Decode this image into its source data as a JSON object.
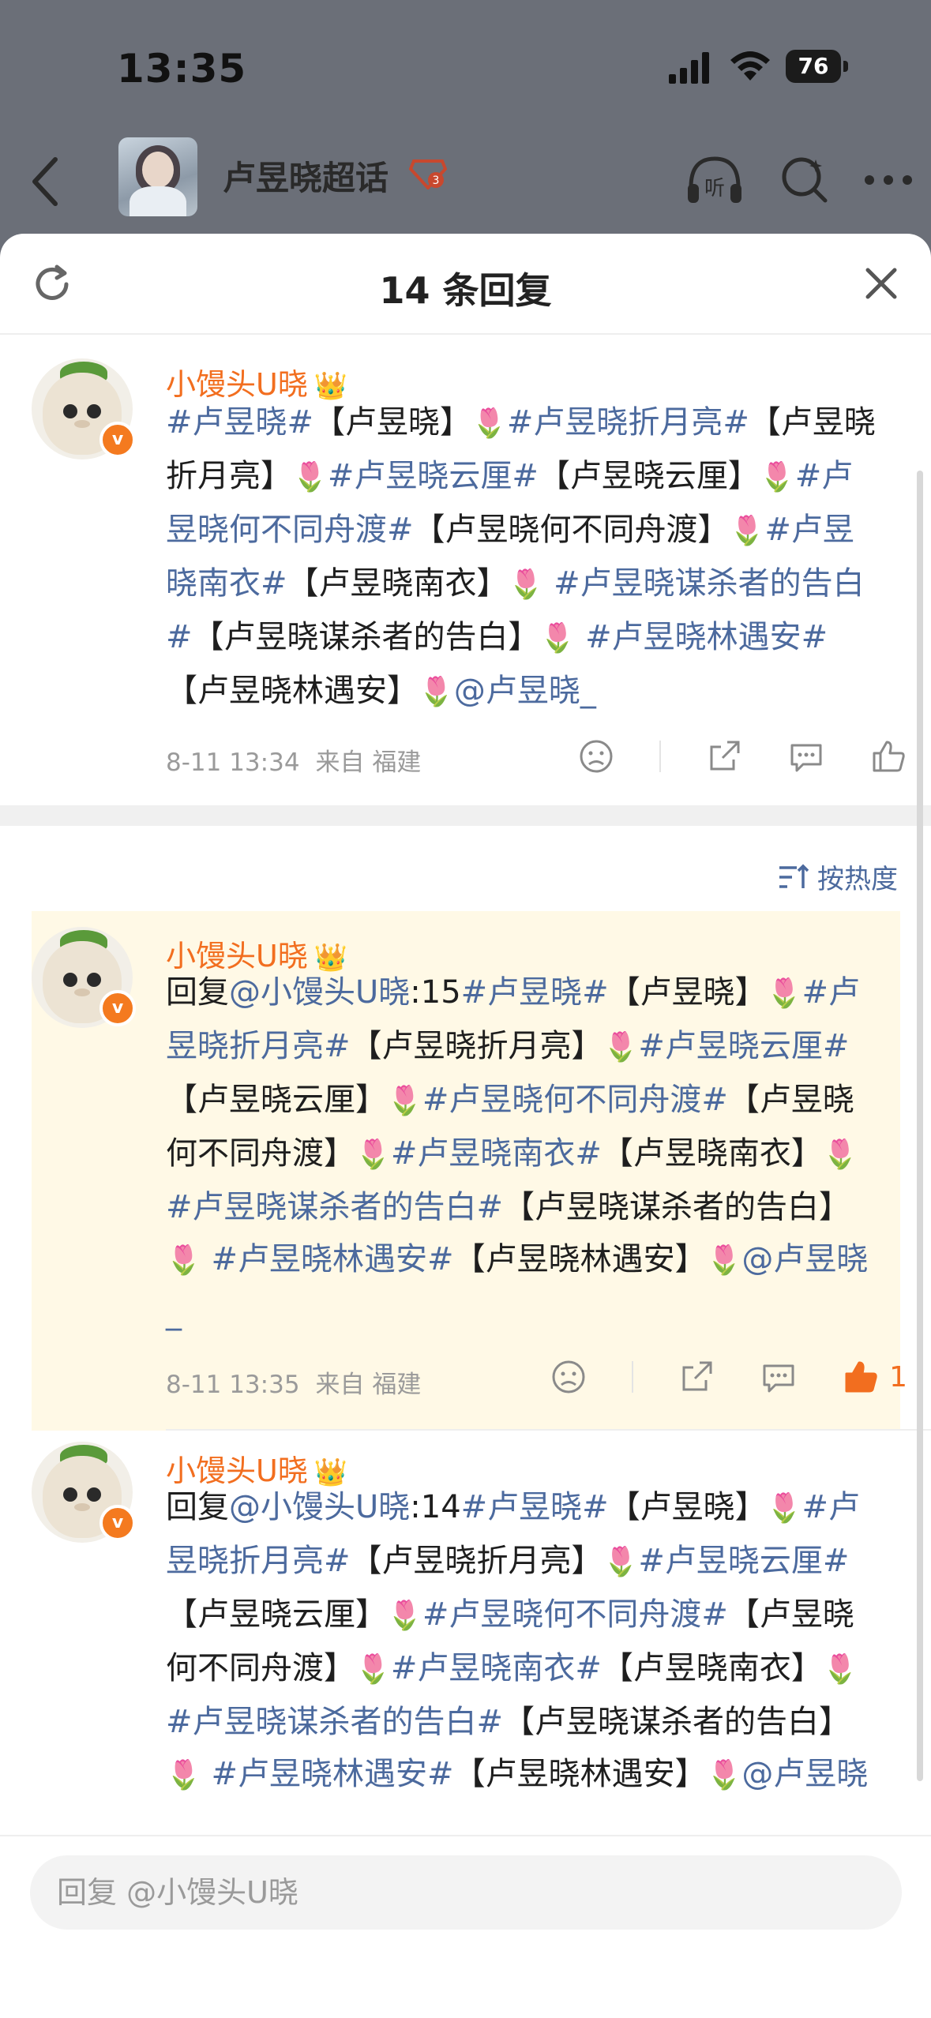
{
  "status": {
    "time": "13:35",
    "battery": "76"
  },
  "topic": {
    "title": "卢昱晓超话",
    "rank": "3"
  },
  "sheet": {
    "title": "14 条回复",
    "sort_label": "按热度"
  },
  "comments": [
    {
      "user": "小馒头U晓",
      "meta": {
        "date": "8-11 13:34",
        "source": "来自 福建"
      },
      "segments_text": "#卢昱晓#【卢昱晓】🌷#卢昱晓折月亮#【卢昱晓折月亮】🌷#卢昱晓云厘#【卢昱晓云厘】🌷#卢昱晓何不同舟渡#【卢昱晓何不同舟渡】🌷#卢昱晓南衣#【卢昱晓南衣】🌷 #卢昱晓谋杀者的告白#【卢昱晓谋杀者的告白】🌷 #卢昱晓林遇安#【卢昱晓林遇安】🌷@卢昱晓_",
      "likes": ""
    },
    {
      "user": "小馒头U晓",
      "meta": {
        "date": "8-11 13:35",
        "source": "来自 福建"
      },
      "reply_prefix": "回复",
      "reply_to": "@小馒头U晓",
      "reply_num": ":15",
      "likes": "1"
    },
    {
      "user": "小馒头U晓",
      "reply_prefix": "回复",
      "reply_to": "@小馒头U晓",
      "reply_num": ":14"
    }
  ],
  "text_parts": {
    "t1": "#卢昱晓#",
    "b1": "【卢昱晓】",
    "t2": "#卢昱晓折月亮#",
    "b2": "【卢昱晓折月亮】",
    "t3": "#卢昱晓云厘#",
    "b3": "【卢昱晓云厘】",
    "t4": "#卢昱晓何不同舟渡#",
    "b4": "【卢昱晓何不同舟渡】",
    "t5": "#卢昱晓南衣#",
    "b5": "【卢昱晓南衣】",
    "t6": "#卢昱晓谋杀者的告白#",
    "b6": "【卢昱晓谋杀者的告白】",
    "t7": "#卢昱晓林遇安#",
    "b7": "【卢昱晓林遇安】",
    "mention": "@卢昱晓_",
    "flower": "🌷"
  },
  "footer": {
    "placeholder": "回复 @小馒头U晓"
  },
  "colors": {
    "accent": "#f26e1f",
    "link": "#4c6a9e",
    "highlight_bg": "#fff9e6"
  }
}
